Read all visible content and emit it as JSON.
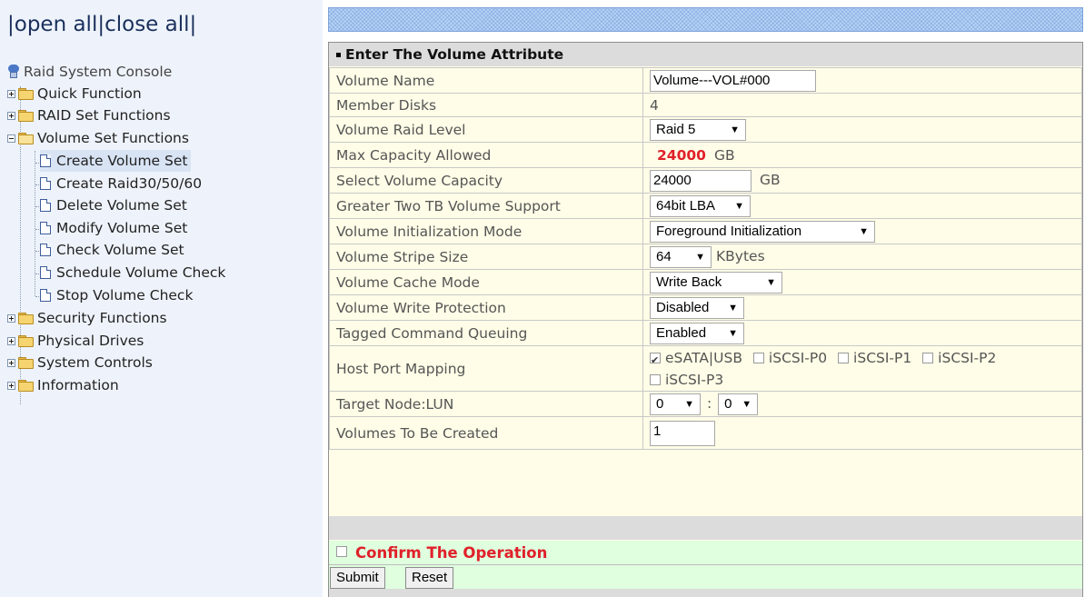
{
  "toggle": {
    "open_all": "open all",
    "close_all": "close all"
  },
  "tree": {
    "root": "Raid System Console",
    "items": [
      {
        "label": "Quick Function"
      },
      {
        "label": "RAID Set Functions"
      },
      {
        "label": "Volume Set Functions"
      },
      {
        "label": "Create Volume Set"
      },
      {
        "label": "Create Raid30/50/60"
      },
      {
        "label": "Delete Volume Set"
      },
      {
        "label": "Modify Volume Set"
      },
      {
        "label": "Check Volume Set"
      },
      {
        "label": "Schedule Volume Check"
      },
      {
        "label": "Stop Volume Check"
      },
      {
        "label": "Security Functions"
      },
      {
        "label": "Physical Drives"
      },
      {
        "label": "System Controls"
      },
      {
        "label": "Information"
      }
    ]
  },
  "form": {
    "header": "Enter The Volume Attribute",
    "rows": [
      {
        "label": "Volume Name",
        "value": "Volume---VOL#000"
      },
      {
        "label": "Member Disks",
        "value": "4"
      },
      {
        "label": "Volume Raid Level",
        "value": "Raid 5"
      },
      {
        "label": "Max Capacity Allowed",
        "value": "24000",
        "unit": "GB"
      },
      {
        "label": "Select Volume Capacity",
        "value": "24000",
        "unit": "GB"
      },
      {
        "label": "Greater Two TB Volume Support",
        "value": "64bit LBA"
      },
      {
        "label": "Volume Initialization Mode",
        "value": "Foreground Initialization"
      },
      {
        "label": "Volume Stripe Size",
        "value": "64",
        "unit": "KBytes"
      },
      {
        "label": "Volume Cache Mode",
        "value": "Write Back"
      },
      {
        "label": "Volume Write Protection",
        "value": "Disabled"
      },
      {
        "label": "Tagged Command Queuing",
        "value": "Enabled"
      },
      {
        "label": "Host Port Mapping",
        "ports": [
          "eSATA|USB",
          "iSCSI-P0",
          "iSCSI-P1",
          "iSCSI-P2",
          "iSCSI-P3"
        ]
      },
      {
        "label": "Target Node:LUN",
        "node": "0",
        "sep": ":",
        "lun": "0"
      },
      {
        "label": "Volumes To Be Created",
        "value": "1"
      }
    ],
    "confirm": "Confirm The Operation",
    "submit": "Submit",
    "reset": "Reset"
  },
  "colors": {
    "confirm_red": "#e0202a",
    "max_capacity_red": "#e0202a",
    "tree_selected": "#d8e3f4"
  }
}
